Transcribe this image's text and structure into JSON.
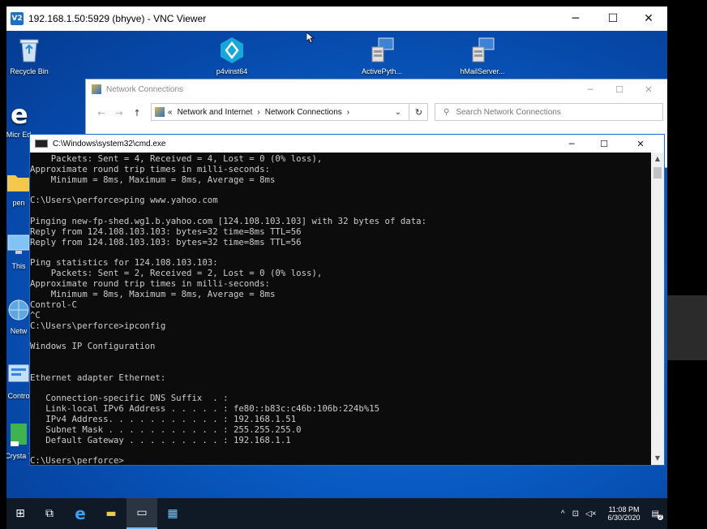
{
  "vnc": {
    "title": "192.168.1.50:5929 (bhyve) - VNC Viewer",
    "logo": "V2",
    "minimize_icon": "─",
    "maximize_icon": "☐",
    "close_icon": "✕"
  },
  "desktop_icons": [
    {
      "label": "Recycle Bin",
      "icon": "recycle-bin-icon"
    },
    {
      "label": "p4vinst64",
      "icon": "p4v-installer-icon"
    },
    {
      "label": "ActivePyth...",
      "icon": "activepython-installer-icon"
    },
    {
      "label": "hMailServer...",
      "icon": "hmailserver-installer-icon"
    },
    {
      "label": "Micr Ed",
      "icon": "edge-icon"
    },
    {
      "label": "pen",
      "icon": "folder-icon"
    },
    {
      "label": "This",
      "icon": "this-pc-icon"
    },
    {
      "label": "Netw",
      "icon": "network-icon"
    },
    {
      "label": "Contro",
      "icon": "control-panel-icon"
    },
    {
      "label": "Crysta 7",
      "icon": "crystal-icon"
    }
  ],
  "explorer": {
    "title": "Network Connections",
    "address_parts": [
      "«",
      "Network and Internet",
      "›",
      "Network Connections",
      "›"
    ],
    "search_placeholder": "Search Network Connections",
    "back_icon": "←",
    "forward_icon": "→",
    "up_icon": "↑",
    "dropdown_icon": "⌄",
    "refresh_icon": "↻",
    "search_icon": "⚲",
    "min_icon": "─",
    "max_icon": "☐",
    "close_icon": "✕"
  },
  "cmd": {
    "title": "C:\\Windows\\system32\\cmd.exe",
    "min_icon": "─",
    "max_icon": "☐",
    "close_icon": "✕",
    "scroll_up": "▲",
    "scroll_down": "▼",
    "lines": [
      "    Packets: Sent = 4, Received = 4, Lost = 0 (0% loss),",
      "Approximate round trip times in milli-seconds:",
      "    Minimum = 8ms, Maximum = 8ms, Average = 8ms",
      "",
      "C:\\Users\\perforce>ping www.yahoo.com",
      "",
      "Pinging new-fp-shed.wg1.b.yahoo.com [124.108.103.103] with 32 bytes of data:",
      "Reply from 124.108.103.103: bytes=32 time=8ms TTL=56",
      "Reply from 124.108.103.103: bytes=32 time=8ms TTL=56",
      "",
      "Ping statistics for 124.108.103.103:",
      "    Packets: Sent = 2, Received = 2, Lost = 0 (0% loss),",
      "Approximate round trip times in milli-seconds:",
      "    Minimum = 8ms, Maximum = 8ms, Average = 8ms",
      "Control-C",
      "^C",
      "C:\\Users\\perforce>ipconfig",
      "",
      "Windows IP Configuration",
      "",
      "",
      "Ethernet adapter Ethernet:",
      "",
      "   Connection-specific DNS Suffix  . :",
      "   Link-local IPv6 Address . . . . . : fe80::b83c:c46b:106b:224b%15",
      "   IPv4 Address. . . . . . . . . . . : 192.168.1.51",
      "   Subnet Mask . . . . . . . . . . . : 255.255.255.0",
      "   Default Gateway . . . . . . . . . : 192.168.1.1",
      "",
      "C:\\Users\\perforce>"
    ]
  },
  "taskbar": {
    "start_icon": "⊞",
    "taskview_icon": "⧉",
    "edge_icon": "e",
    "explorer_icon": "▬",
    "cmd_icon": "▭",
    "network_icon": "▦",
    "tray_chevron": "^",
    "tray_network": "⊡",
    "tray_volume": "◁×",
    "time": "11:08 PM",
    "date": "6/30/2020",
    "notif_icon": "▤",
    "notif_count": "2"
  }
}
